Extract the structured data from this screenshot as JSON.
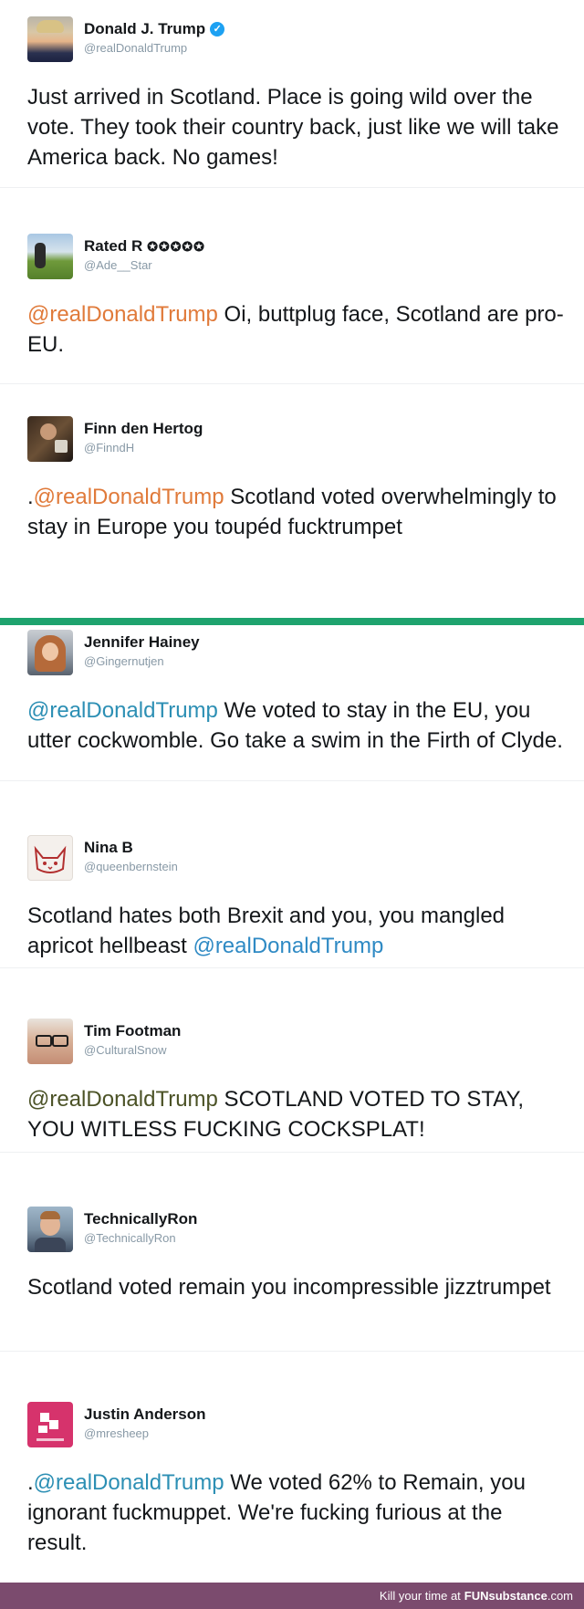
{
  "colors": {
    "mention_orange": "#e07a3a",
    "mention_teal": "#2c8fb4",
    "mention_olive": "#4b5226",
    "divider_green": "#1ea36e",
    "footer_bg": "#7b4b6e",
    "verified_blue": "#1da1f2"
  },
  "tweets": [
    {
      "name": "Donald J. Trump",
      "handle": "@realDonaldTrump",
      "verified": true,
      "icon": "verified-badge-icon",
      "text": "Just arrived in Scotland. Place is going wild over the vote. They took their country back, just like we will take America back. No games!"
    },
    {
      "name": "Rated R",
      "badge": "✪✪✪✪✪",
      "handle": "@Ade__Star",
      "mention": "@realDonaldTrump",
      "text": " Oi, buttplug face, Scotland are pro-EU."
    },
    {
      "name": "Finn den Hertog",
      "handle": "@FinndH",
      "prefix": ".",
      "mention": "@realDonaldTrump",
      "text": " Scotland voted overwhelmingly to stay in Europe you toupéd fucktrumpet"
    },
    {
      "name": "Jennifer Hainey",
      "handle": "@Gingernutjen",
      "mention": "@realDonaldTrump",
      "text": " We voted to stay in the EU, you utter cockwomble. Go take a swim in the Firth of Clyde."
    },
    {
      "name": "Nina B",
      "handle": "@queenbernstein",
      "text": "Scotland hates both Brexit and you, you mangled apricot hellbeast ",
      "mention": "@realDonaldTrump"
    },
    {
      "name": "Tim Footman",
      "handle": "@CulturalSnow",
      "mention": "@realDonaldTrump",
      "text": " SCOTLAND VOTED TO STAY, YOU WITLESS FUCKING COCKSPLAT!"
    },
    {
      "name": "TechnicallyRon",
      "handle": "@TechnicallyRon",
      "text": "Scotland voted remain you incompressible jizztrumpet"
    },
    {
      "name": "Justin Anderson",
      "handle": "@mresheep",
      "prefix": ".",
      "mention": "@realDonaldTrump",
      "text": " We voted 62% to Remain, you ignorant fuckmuppet. We're fucking furious at the result."
    }
  ],
  "footer": {
    "tagline": "Kill your time at",
    "brand_bold": "FUNsubstance",
    "brand_light": ".com"
  }
}
